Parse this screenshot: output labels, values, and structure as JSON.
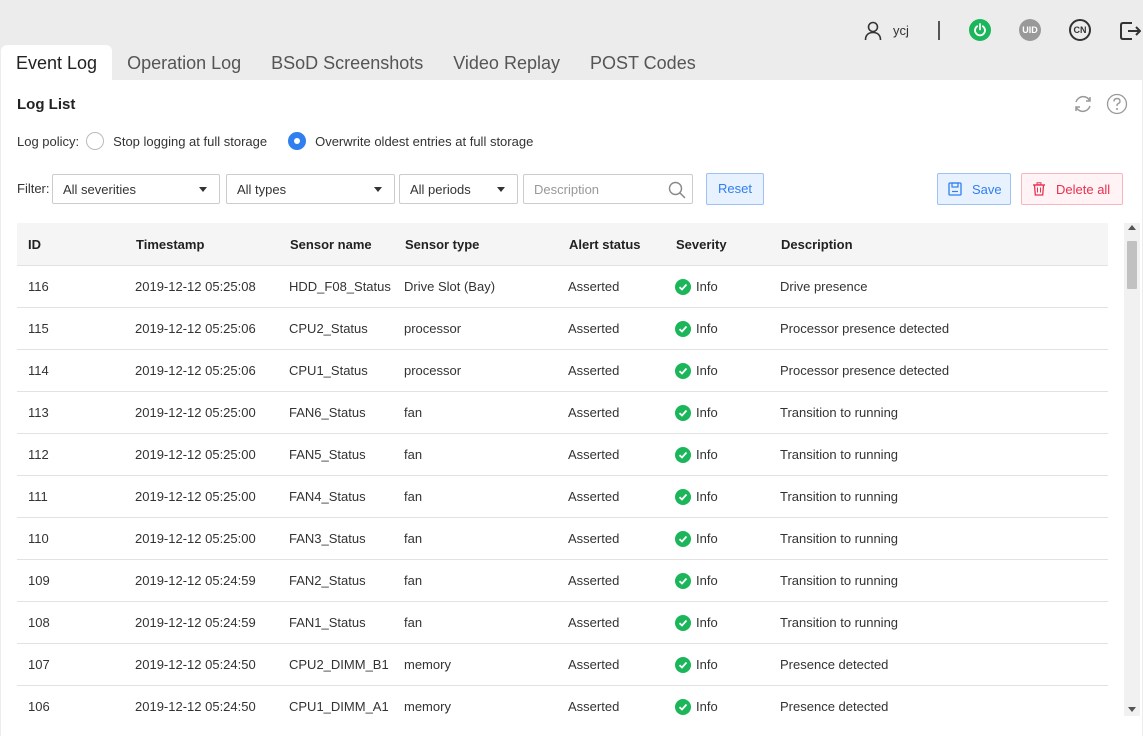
{
  "header": {
    "user_name": "ycj",
    "uid_label": "UID",
    "lang_label": "CN",
    "power_color": "#1bb55a"
  },
  "tabs": [
    {
      "label": "Event Log",
      "active": true
    },
    {
      "label": "Operation Log"
    },
    {
      "label": "BSoD Screenshots"
    },
    {
      "label": "Video Replay"
    },
    {
      "label": "POST Codes"
    }
  ],
  "panel": {
    "title": "Log List",
    "policy_label": "Log policy:",
    "policy_options": [
      {
        "label": "Stop logging at full storage",
        "checked": false
      },
      {
        "label": "Overwrite oldest entries at full storage",
        "checked": true
      }
    ],
    "filter_label": "Filter:",
    "filters": {
      "severity": "All severities",
      "type": "All types",
      "period": "All periods",
      "description_placeholder": "Description"
    },
    "reset_label": "Reset",
    "save_label": "Save",
    "delete_label": "Delete all"
  },
  "table": {
    "columns": [
      "ID",
      "Timestamp",
      "Sensor name",
      "Sensor type",
      "Alert status",
      "Severity",
      "Description"
    ],
    "rows": [
      {
        "id": "116",
        "ts": "2019-12-12 05:25:08",
        "sensor": "HDD_F08_Status",
        "type": "Drive Slot (Bay)",
        "status": "Asserted",
        "severity": "Info",
        "desc": "Drive presence"
      },
      {
        "id": "115",
        "ts": "2019-12-12 05:25:06",
        "sensor": "CPU2_Status",
        "type": "processor",
        "status": "Asserted",
        "severity": "Info",
        "desc": "Processor presence detected"
      },
      {
        "id": "114",
        "ts": "2019-12-12 05:25:06",
        "sensor": "CPU1_Status",
        "type": "processor",
        "status": "Asserted",
        "severity": "Info",
        "desc": "Processor presence detected"
      },
      {
        "id": "113",
        "ts": "2019-12-12 05:25:00",
        "sensor": "FAN6_Status",
        "type": "fan",
        "status": "Asserted",
        "severity": "Info",
        "desc": "Transition to running"
      },
      {
        "id": "112",
        "ts": "2019-12-12 05:25:00",
        "sensor": "FAN5_Status",
        "type": "fan",
        "status": "Asserted",
        "severity": "Info",
        "desc": "Transition to running"
      },
      {
        "id": "111",
        "ts": "2019-12-12 05:25:00",
        "sensor": "FAN4_Status",
        "type": "fan",
        "status": "Asserted",
        "severity": "Info",
        "desc": "Transition to running"
      },
      {
        "id": "110",
        "ts": "2019-12-12 05:25:00",
        "sensor": "FAN3_Status",
        "type": "fan",
        "status": "Asserted",
        "severity": "Info",
        "desc": "Transition to running"
      },
      {
        "id": "109",
        "ts": "2019-12-12 05:24:59",
        "sensor": "FAN2_Status",
        "type": "fan",
        "status": "Asserted",
        "severity": "Info",
        "desc": "Transition to running"
      },
      {
        "id": "108",
        "ts": "2019-12-12 05:24:59",
        "sensor": "FAN1_Status",
        "type": "fan",
        "status": "Asserted",
        "severity": "Info",
        "desc": "Transition to running"
      },
      {
        "id": "107",
        "ts": "2019-12-12 05:24:50",
        "sensor": "CPU2_DIMM_B1",
        "type": "memory",
        "status": "Asserted",
        "severity": "Info",
        "desc": "Presence detected"
      },
      {
        "id": "106",
        "ts": "2019-12-12 05:24:50",
        "sensor": "CPU1_DIMM_A1",
        "type": "memory",
        "status": "Asserted",
        "severity": "Info",
        "desc": "Presence detected"
      }
    ]
  }
}
